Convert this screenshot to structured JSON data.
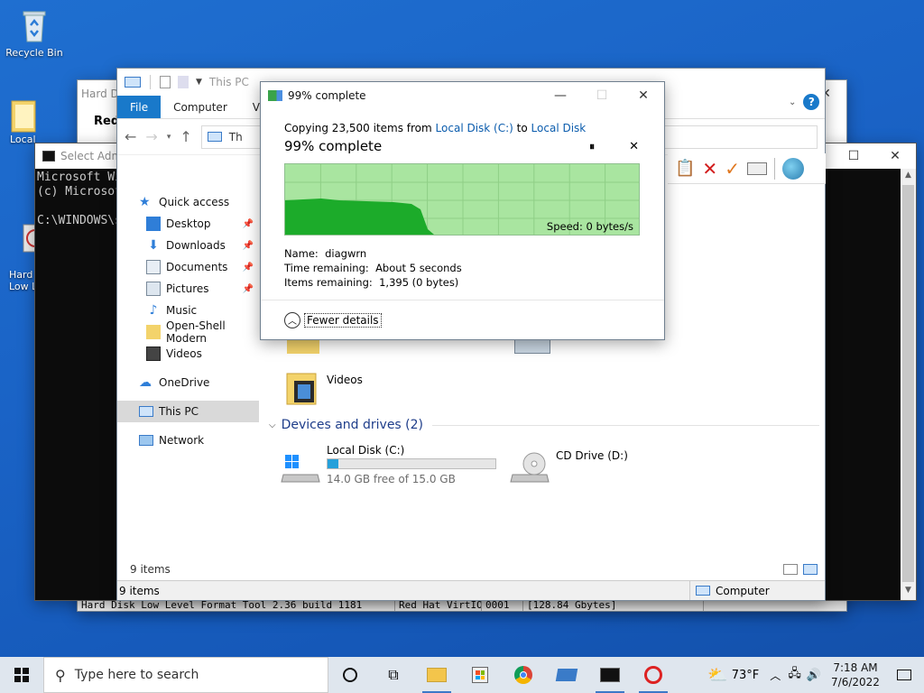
{
  "desktop": {
    "icons": [
      {
        "label": "Recycle Bin"
      },
      {
        "label": "Local"
      },
      {
        "label": "Hard\nLow L"
      }
    ]
  },
  "hdd_window": {
    "title": "Hard Di",
    "heading": "Red",
    "bottom_row": [
      "Hard Disk Low Level Format Tool 2.36 build 1181",
      "Red Hat VirtIO",
      "0001",
      "[128.84 Gbytes]"
    ]
  },
  "cmd_window": {
    "title": "Select Adm",
    "lines": "Microsoft Wi\n(c) Microsof\n\nC:\\WINDOWS\\s"
  },
  "explorer": {
    "title": "This PC",
    "tabs": [
      "File",
      "Computer",
      "Vi"
    ],
    "address": "Th",
    "sidebar": {
      "quick_access": "Quick access",
      "items": [
        "Desktop",
        "Downloads",
        "Documents",
        "Pictures",
        "Music",
        "Open-Shell Modern",
        "Videos"
      ],
      "onedrive": "OneDrive",
      "this_pc": "This PC",
      "network": "Network"
    },
    "videos_label": "Videos",
    "devices_heading": "Devices and drives (2)",
    "drives": [
      {
        "name": "Local Disk (C:)",
        "free": "14.0 GB free of 15.0 GB",
        "used_fraction": 0.067
      },
      {
        "name": "CD Drive (D:)"
      }
    ],
    "item_count": "9 items",
    "outer_status": {
      "items": "9 items",
      "location": "Computer"
    }
  },
  "copy_dialog": {
    "title": "99% complete",
    "copying_prefix": "Copying 23,500 items from",
    "source": "Local Disk (C:)",
    "to": "to",
    "destination": "Local Disk",
    "percent": "99% complete",
    "speed": "Speed: 0 bytes/s",
    "name_label": "Name:",
    "name_value": "diagwrn",
    "time_label": "Time remaining:",
    "time_value": "About 5 seconds",
    "items_label": "Items remaining:",
    "items_value": "1,395 (0 bytes)",
    "fewer_details": "Fewer details",
    "progress": 0.99
  },
  "taskbar": {
    "search_placeholder": "Type here to search",
    "weather": "73°F",
    "time": "7:18 AM",
    "date": "7/6/2022"
  },
  "colors": {
    "accent": "#1979ca",
    "graph_bg": "#a9e5a0",
    "graph_fill": "#1cab2a",
    "link": "#0b5cad"
  }
}
